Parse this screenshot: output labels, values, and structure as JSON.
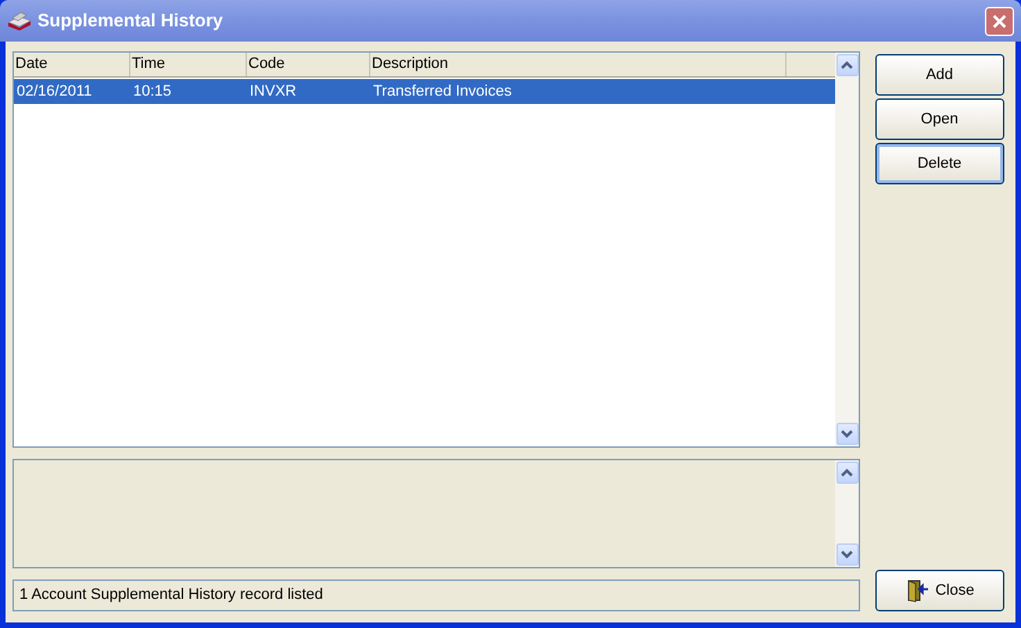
{
  "window": {
    "title": "Supplemental History"
  },
  "table": {
    "columns": [
      "Date",
      "Time",
      "Code",
      "Description"
    ],
    "rows": [
      {
        "cells": [
          "02/16/2011",
          "10:15",
          "INVXR",
          "Transferred Invoices"
        ],
        "selected": true
      }
    ]
  },
  "buttons": [
    {
      "label": "Add",
      "focused": false
    },
    {
      "label": "Open",
      "focused": false
    },
    {
      "label": "Delete",
      "focused": true
    }
  ],
  "status_bar": "1 Account Supplemental History record listed",
  "close_button": "Close"
}
